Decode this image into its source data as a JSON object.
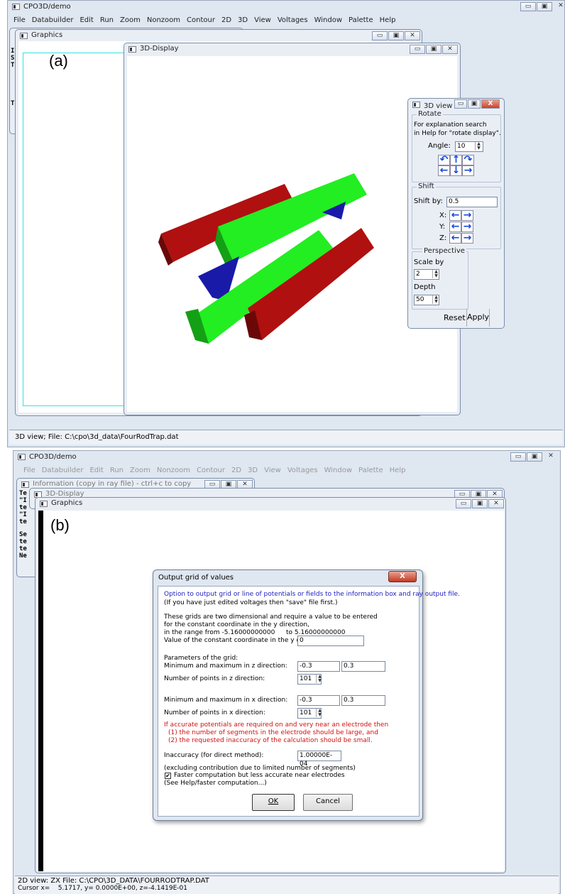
{
  "panel_a": {
    "label": "(a)",
    "app_title": "CPO3D/demo",
    "menu": [
      "File",
      "Databuilder",
      "Edit",
      "Run",
      "Zoom",
      "Nonzoom",
      "Contour",
      "2D",
      "3D",
      "View",
      "Voltages",
      "Window",
      "Palette",
      "Help"
    ],
    "graphics_title": "Graphics",
    "display_title": "3D-Display",
    "left_letters": [
      "I",
      "S",
      "T",
      "T"
    ],
    "status": "3D view; File: C:\\cpo\\3d_data\\FourRodTrap.dat",
    "view3d": {
      "title": "3D view",
      "rotate_legend": "Rotate",
      "explanation_1": "For explanation search",
      "explanation_2": "in Help for \"rotate display\".",
      "angle_label": "Angle:",
      "angle_value": "10",
      "shift_legend": "Shift",
      "shift_label": "Shift by:",
      "shift_value": "0.5",
      "x_label": "X:",
      "y_label": "Y:",
      "z_label": "Z:",
      "perspective_legend": "Perspective",
      "scale_label": "Scale by",
      "scale_value": "2",
      "depth_label": "Depth",
      "depth_value": "50",
      "reset_label": "Reset",
      "apply_label": "Apply"
    },
    "colors": {
      "red_rod": "#b01010",
      "green_rod": "#22ee22",
      "blue_block": "#1a1aa8"
    }
  },
  "panel_b": {
    "label": "(b)",
    "app_title": "CPO3D/demo",
    "menu": [
      "File",
      "Databuilder",
      "Edit",
      "Run",
      "Zoom",
      "Nonzoom",
      "Contour",
      "2D",
      "3D",
      "View",
      "Voltages",
      "Window",
      "Palette",
      "Help"
    ],
    "info_title": "Information (copy in ray file) - ctrl+c to copy",
    "display_title": "3D-Display",
    "graphics_title": "Graphics",
    "left_text": [
      "Te",
      "\"I",
      "te",
      "\"I",
      "te",
      "",
      "Se",
      "te",
      "te",
      "Ne"
    ],
    "status_line1": "2D view: ZX  File: C:\\CPO\\3D_DATA\\FOURRODTRAP.DAT",
    "status_line2": "Cursor x=    5.1717, y= 0.0000E+00, z=-4.1419E-01",
    "dialog": {
      "title": "Output grid of values",
      "close_glyph": "X",
      "intro_blue": "Option to output grid or line of potentials or fields to the information box and ray output file.",
      "intro_note": "(If you have just edited voltages then \"save\" file first.)",
      "desc1": "These grids are two dimensional and require a value to be entered",
      "desc2": "for the constant coordinate in the y direction,",
      "range_prefix": "in the range from   -5.16000000000",
      "range_to": "to 5.16000000000",
      "const_label": "Value of the constant coordinate in the y direction:",
      "const_value": "0",
      "params_title": "Parameters of the grid:",
      "z_minmax_label": "Minimum and maximum in z direction:",
      "z_min": "-0.3",
      "z_max": "0.3",
      "z_points_label": "Number of points in z direction:",
      "z_points": "101",
      "x_minmax_label": "Minimum and maximum in x direction:",
      "x_min": "-0.3",
      "x_max": "0.3",
      "x_points_label": "Number of points in x direction:",
      "x_points": "101",
      "warn1": "If accurate potentials are required on and very near an electrode then",
      "warn2": "(1) the number of segments in the electrode should be large, and",
      "warn3": "(2) the requested inaccuracy of the calculation should be small.",
      "inaccuracy_label": "Inaccuracy (for direct method):",
      "inaccuracy_value": "1.00000E-04",
      "excl_note": "(excluding contribution due to limited number of segments)",
      "faster_label": "Faster computation but less accurate near electrodes",
      "faster_checked": "✔",
      "see_help": "(See Help/faster computation...)",
      "ok_label": "OK",
      "cancel_label": "Cancel"
    },
    "colors": {
      "blue_text": "#2020c0",
      "red_text": "#d01010"
    }
  }
}
